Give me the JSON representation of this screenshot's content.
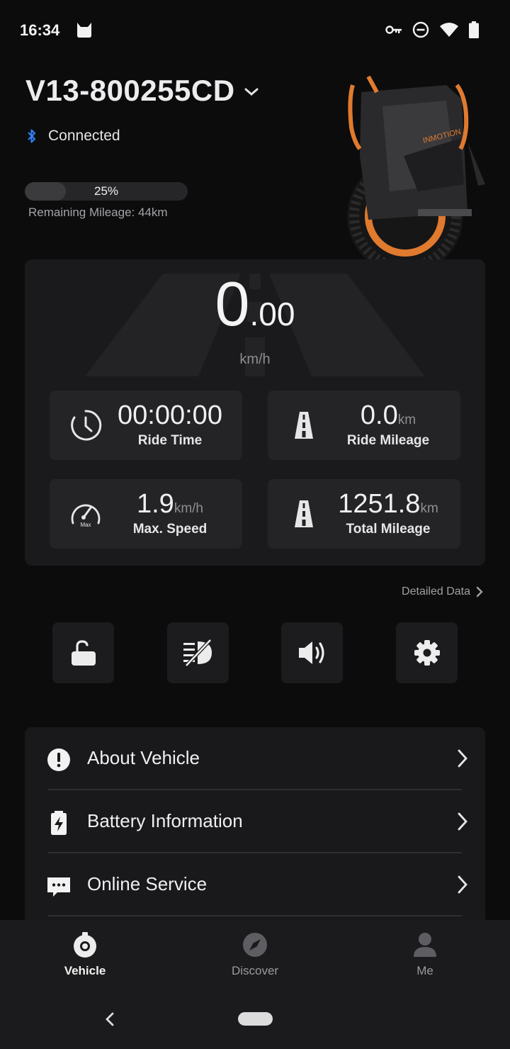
{
  "status_bar": {
    "time": "16:34",
    "icons": [
      "cat-notification-icon",
      "vpn-key-icon",
      "do-not-disturb-icon",
      "wifi-icon",
      "battery-icon"
    ]
  },
  "header": {
    "device_name": "V13-800255CD",
    "connection_status": "Connected",
    "battery_percent": 25,
    "battery_label": "25%",
    "remaining_mileage": "Remaining Mileage: 44km"
  },
  "speed": {
    "integer": "0",
    "decimal": ".00",
    "unit": "km/h"
  },
  "stats": [
    {
      "value": "00:00:00",
      "unit": "",
      "label": "Ride Time",
      "icon": "clock-icon"
    },
    {
      "value": "0.0",
      "unit": "km",
      "label": "Ride Mileage",
      "icon": "road-icon"
    },
    {
      "value": "1.9",
      "unit": "km/h",
      "label": "Max. Speed",
      "icon": "speedometer-icon"
    },
    {
      "value": "1251.8",
      "unit": "km",
      "label": "Total Mileage",
      "icon": "road-icon"
    }
  ],
  "detailed_data": "Detailed Data",
  "quick_actions": [
    "unlock-icon",
    "headlight-off-icon",
    "speaker-icon",
    "gear-icon"
  ],
  "menu": [
    {
      "label": "About Vehicle",
      "icon": "info-icon"
    },
    {
      "label": "Battery Information",
      "icon": "battery-charge-icon"
    },
    {
      "label": "Online Service",
      "icon": "chat-icon"
    }
  ],
  "nav": [
    {
      "label": "Vehicle",
      "icon": "wheel-icon",
      "active": true
    },
    {
      "label": "Discover",
      "icon": "compass-icon",
      "active": false
    },
    {
      "label": "Me",
      "icon": "person-icon",
      "active": false
    }
  ],
  "colors": {
    "background": "#0c0c0d",
    "panel": "#1a1a1c",
    "card": "#242426",
    "bluetooth": "#2f7ff0",
    "accent_orange": "#e07a2e"
  }
}
